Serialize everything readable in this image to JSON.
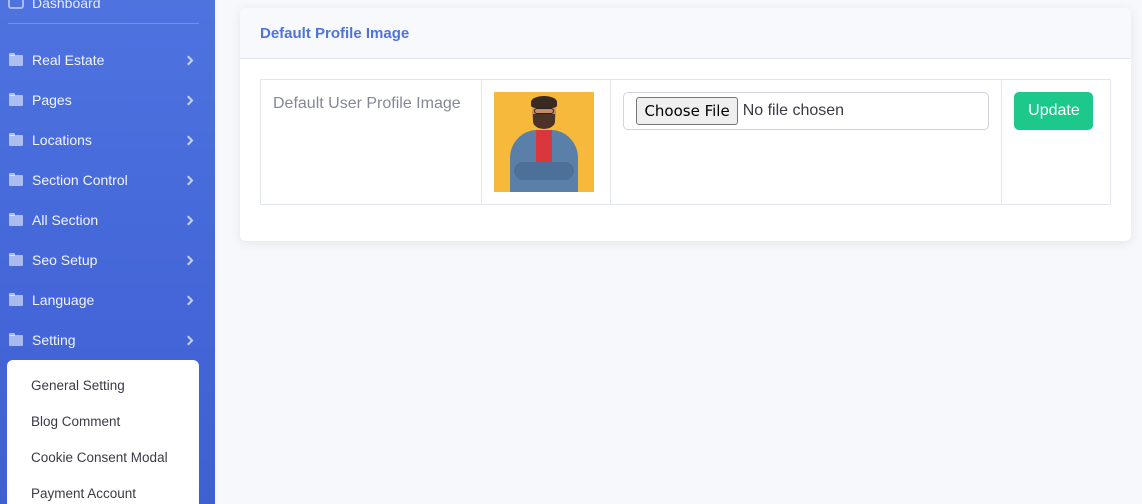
{
  "sidebar": {
    "dashboard_label": "Dashboard",
    "items": [
      {
        "label": "Real Estate"
      },
      {
        "label": "Pages"
      },
      {
        "label": "Locations"
      },
      {
        "label": "Section Control"
      },
      {
        "label": "All Section"
      },
      {
        "label": "Seo Setup"
      },
      {
        "label": "Language"
      },
      {
        "label": "Setting"
      }
    ],
    "submenu": [
      {
        "label": "General Setting"
      },
      {
        "label": "Blog Comment"
      },
      {
        "label": "Cookie Consent Modal"
      },
      {
        "label": "Payment Account"
      }
    ]
  },
  "card": {
    "title": "Default Profile Image",
    "row_label": "Default User Profile Image",
    "file_input": {
      "button_label": "Choose File",
      "status": "No file chosen"
    },
    "update_label": "Update"
  },
  "colors": {
    "sidebar": "#4e73df",
    "primary": "#4e73df",
    "success": "#1cc88a"
  }
}
